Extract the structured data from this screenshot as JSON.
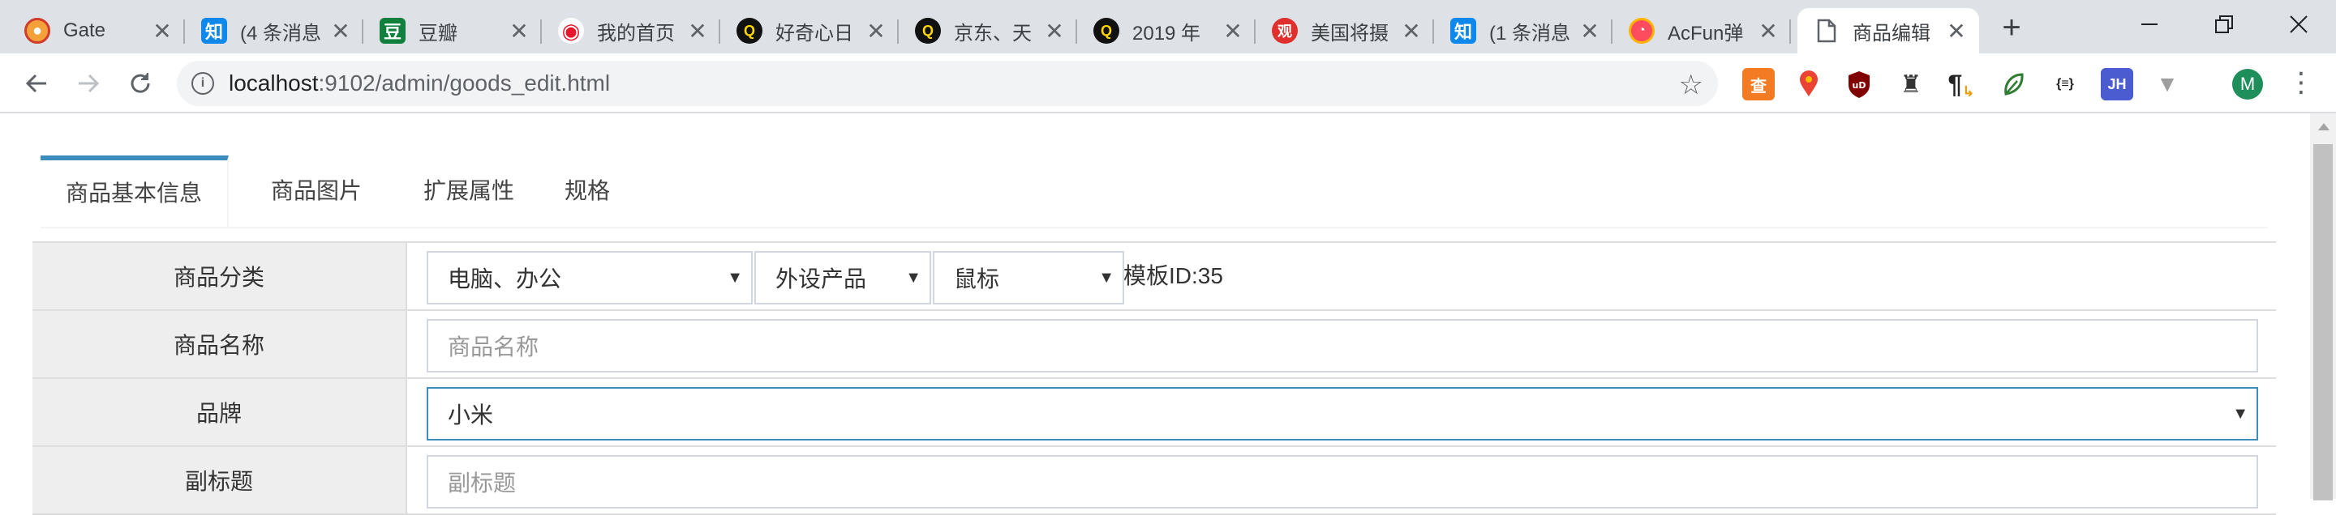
{
  "browser": {
    "tabs": [
      {
        "title": "Gate",
        "icon": "gate-icon"
      },
      {
        "title": "(4 条消息",
        "icon": "zhihu-icon"
      },
      {
        "title": "豆瓣",
        "icon": "douban-icon"
      },
      {
        "title": "我的首页",
        "icon": "weibo-icon"
      },
      {
        "title": "好奇心日",
        "icon": "qdaily-icon"
      },
      {
        "title": "京东、天",
        "icon": "qdaily-icon"
      },
      {
        "title": "2019 年",
        "icon": "qdaily-icon"
      },
      {
        "title": "美国将摄",
        "icon": "guancha-icon"
      },
      {
        "title": "(1 条消息",
        "icon": "zhihu-icon"
      },
      {
        "title": "AcFun弹",
        "icon": "acfun-icon"
      },
      {
        "title": "商品编辑",
        "icon": "page-icon",
        "active": true
      }
    ],
    "url_host": "localhost",
    "url_path": ":9102/admin/goods_edit.html",
    "avatar_letter": "M",
    "extensions": [
      "baidu-ext-icon",
      "map-pin-ext-icon",
      "ublock-ext-icon",
      "spy-ext-icon",
      "pilcrow-ext-icon",
      "leaf-ext-icon",
      "json-ext-icon",
      "jh-ext-icon",
      "vue-ext-icon"
    ],
    "ext_labels": {
      "baidu": "查",
      "ublock": "uD",
      "pilcrow": "¶",
      "json": "{≡}",
      "jh": "JH",
      "vue": "▼"
    }
  },
  "page": {
    "tabs": [
      "商品基本信息",
      "商品图片",
      "扩展属性",
      "规格"
    ],
    "active_tab": 0,
    "form": {
      "category": {
        "label": "商品分类",
        "level1": "电脑、办公",
        "level2": "外设产品",
        "level3": "鼠标",
        "template": "模板ID:35"
      },
      "name": {
        "label": "商品名称",
        "placeholder": "商品名称",
        "value": ""
      },
      "brand": {
        "label": "品牌",
        "value": "小米"
      },
      "caption": {
        "label": "副标题",
        "placeholder": "副标题",
        "value": ""
      }
    }
  },
  "colors": {
    "accent": "#3c8dbc",
    "label_bg": "#eeeeee",
    "tabstrip": "#dee1e6"
  }
}
